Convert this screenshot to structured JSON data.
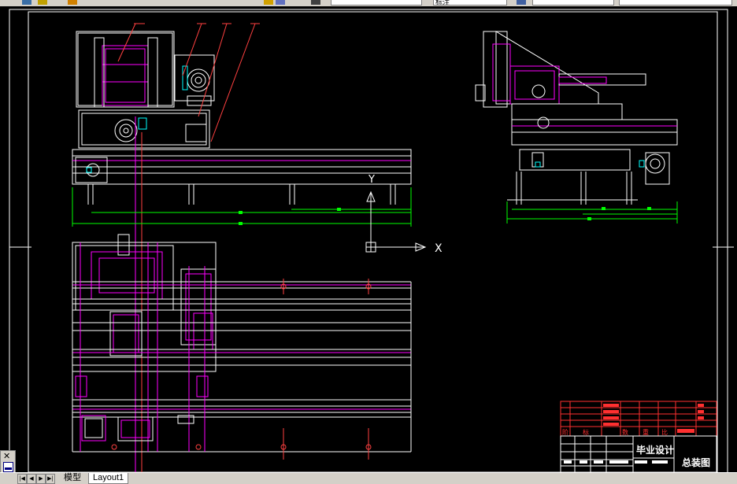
{
  "app": {
    "name": "CAD drawing viewer"
  },
  "toolbar": {
    "combo1_value": "",
    "combo2_value": "标注",
    "combo3_value": "",
    "icons": [
      "layer-icon",
      "properties-icon",
      "match-icon",
      "layer-state-icon",
      "dim-style-icon",
      "table-style-icon"
    ]
  },
  "drawing": {
    "ucs": {
      "x_label": "X",
      "y_label": "Y"
    },
    "colors": {
      "background": "#000000",
      "outline": "#ffffff",
      "part": "#ff00ff",
      "dimension": "#00ff00",
      "leader": "#ff4040",
      "titleblock": "#ff3030",
      "accent": "#00ffff"
    }
  },
  "title_block": {
    "project_title": "毕业设计",
    "drawing_name": "总装图",
    "header_cells": [
      "阶",
      "标",
      "数",
      "重",
      "比"
    ]
  },
  "tabs": {
    "nav_buttons": [
      "|◀",
      "◀",
      "▶",
      "▶|"
    ],
    "model": "模型",
    "layout1": "Layout1"
  }
}
